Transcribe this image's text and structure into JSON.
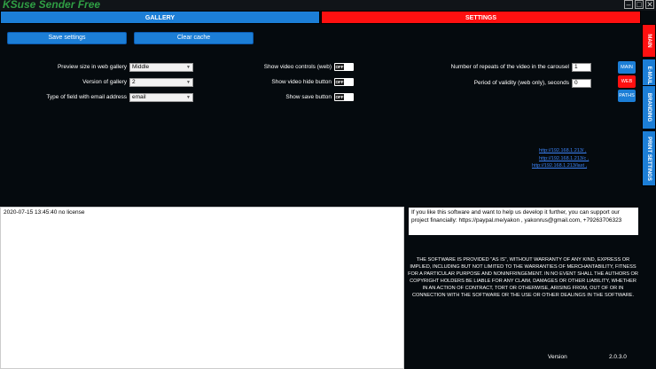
{
  "app": {
    "title": "KSuse Sender Free"
  },
  "window_controls": {
    "minimize": "–",
    "maximize": "□",
    "close": "✕"
  },
  "tabs": {
    "gallery": "GALLERY",
    "settings": "SETTINGS"
  },
  "toolbar": {
    "save_settings": "Save settings",
    "clear_cache": "Clear cache"
  },
  "gallery_settings": {
    "preview_size_label": "Preview size in web gallery",
    "preview_size_value": "Middle",
    "version_label": "Version of gallery",
    "version_value": "2",
    "email_field_label": "Type of field with email address",
    "email_field_value": "email"
  },
  "video_settings": {
    "show_controls_label": "Show video controls (web)",
    "hide_button_label": "Show video hide button",
    "save_button_label": "Show save button",
    "toggle_off": "OFF"
  },
  "carousel_settings": {
    "repeats_label": "Number of repeats of the video in the carousel",
    "repeats_value": "1",
    "validity_label": "Period of validity (web only), seconds",
    "validity_value": "0"
  },
  "side_buttons": {
    "main": "MAIN",
    "web": "WEB",
    "paths": "PATHS"
  },
  "vertical_tabs": {
    "main": "MAIN",
    "email": "E-MAIL",
    "branding": "BRANDING",
    "print": "PRINT SETTINGS"
  },
  "links": [
    "http://192.168.1.213/ ,",
    "http://192.168.1.213/c ,",
    "http://192.168.1.213/last ,"
  ],
  "log": {
    "entry": "2020-07-15 13:45:40 no license"
  },
  "support": {
    "text": "If you like this software and want to help us develop it further, you can support our project financially: https://paypal.me/yakon , yakonrus@gmail.com, +79263706323"
  },
  "license_text": "THE SOFTWARE IS PROVIDED \"AS IS\", WITHOUT WARRANTY OF ANY KIND, EXPRESS OR IMPLIED, INCLUDING BUT NOT LIMITED TO THE WARRANTIES OF MERCHANTABILITY, FITNESS FOR A PARTICULAR PURPOSE AND NONINFRINGEMENT. IN NO EVENT SHALL THE AUTHORS OR COPYRIGHT HOLDERS BE LIABLE FOR ANY CLAIM, DAMAGES OR OTHER LIABILITY, WHETHER IN AN ACTION OF CONTRACT, TORT OR OTHERWISE, ARISING FROM, OUT OF OR IN CONNECTION WITH THE SOFTWARE OR THE USE OR OTHER DEALINGS IN THE SOFTWARE.",
  "version": {
    "label": "Version",
    "value": "2.0.3.0"
  },
  "colors": {
    "accent_blue": "#1c7ed6",
    "accent_red": "#ff1010",
    "title_green": "#2f9e44",
    "background": "#050a0e"
  }
}
